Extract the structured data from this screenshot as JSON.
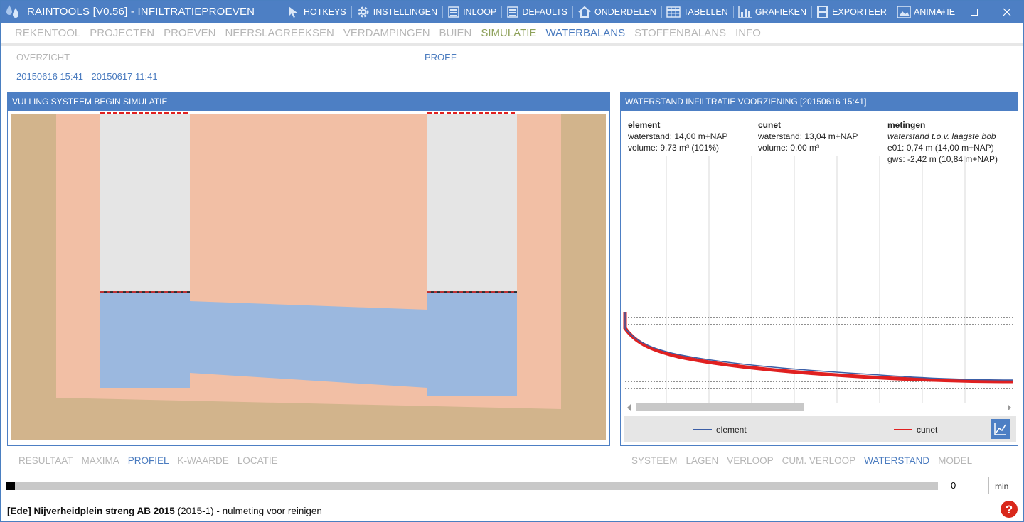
{
  "window": {
    "title": "RAINTOOLS [V0.56] - INFILTRATIEPROEVEN"
  },
  "toolbar": [
    {
      "label": "HOTKEYS",
      "icon": "cursor-icon"
    },
    {
      "label": "INSTELLINGEN",
      "icon": "gear-icon"
    },
    {
      "label": "INLOOP",
      "icon": "list-icon"
    },
    {
      "label": "DEFAULTS",
      "icon": "list-icon"
    },
    {
      "label": "ONDERDELEN",
      "icon": "home-icon"
    },
    {
      "label": "TABELLEN",
      "icon": "table-icon"
    },
    {
      "label": "GRAFIEKEN",
      "icon": "bar-chart-icon"
    },
    {
      "label": "EXPORTEER",
      "icon": "save-icon"
    },
    {
      "label": "ANIMATIE",
      "icon": "image-icon"
    }
  ],
  "main_menu": [
    {
      "label": "REKENTOOL",
      "state": "inactive"
    },
    {
      "label": "PROJECTEN",
      "state": "inactive"
    },
    {
      "label": "PROEVEN",
      "state": "inactive"
    },
    {
      "label": "NEERSLAGREEKSEN",
      "state": "inactive"
    },
    {
      "label": "VERDAMPINGEN",
      "state": "inactive"
    },
    {
      "label": "BUIEN",
      "state": "inactive"
    },
    {
      "label": "SIMULATIE",
      "state": "green"
    },
    {
      "label": "WATERBALANS",
      "state": "blue"
    },
    {
      "label": "STOFFENBALANS",
      "state": "inactive"
    },
    {
      "label": "INFO",
      "state": "inactive"
    }
  ],
  "sub": {
    "overzicht": "OVERZICHT",
    "proef": "PROEF",
    "daterange": "20150616 15:41 - 20150617 11:41"
  },
  "left_panel": {
    "title": "VULLING SYSTEEM BEGIN SIMULATIE",
    "tabs": [
      {
        "label": "RESULTAAT",
        "active": false
      },
      {
        "label": "MAXIMA",
        "active": false
      },
      {
        "label": "PROFIEL",
        "active": true
      },
      {
        "label": "K-WAARDE",
        "active": false
      },
      {
        "label": "LOCATIE",
        "active": false
      }
    ]
  },
  "right_panel": {
    "title": "WATERSTAND INFILTRATIE VOORZIENING [20150616 15:41]",
    "element": {
      "heading": "element",
      "waterstand": "waterstand: 14,00 m+NAP",
      "volume": "volume: 9,73 m³ (101%)"
    },
    "cunet": {
      "heading": "cunet",
      "waterstand": "waterstand: 13,04 m+NAP",
      "volume": "volume: 0,00 m³"
    },
    "metingen": {
      "heading": "metingen",
      "subtitle": "waterstand t.o.v. laagste bob",
      "e01": "e01: 0,74 m (14,00 m+NAP)",
      "gws": "gws: -2,42 m (10,84 m+NAP)"
    },
    "legend": [
      {
        "label": "element",
        "color": "#3b5ea6"
      },
      {
        "label": "cunet",
        "color": "#e02020"
      }
    ],
    "tabs": [
      {
        "label": "SYSTEEM",
        "active": false
      },
      {
        "label": "LAGEN",
        "active": false
      },
      {
        "label": "VERLOOP",
        "active": false
      },
      {
        "label": "CUM. VERLOOP",
        "active": false
      },
      {
        "label": "WATERSTAND",
        "active": true
      },
      {
        "label": "MODEL",
        "active": false
      }
    ]
  },
  "time_control": {
    "value": "0",
    "unit": "min"
  },
  "status": {
    "bold": "[Ede] Nijverheidplein streng AB 2015",
    "normal": " (2015-1) - nulmeting voor reinigen"
  },
  "colors": {
    "accent": "#4d7fc4",
    "soil": "#d2b48c",
    "fill_sand": "#f2bfa5",
    "water": "#9bb8df",
    "air": "#e5e5e5",
    "dashed_red": "#e02020"
  }
}
